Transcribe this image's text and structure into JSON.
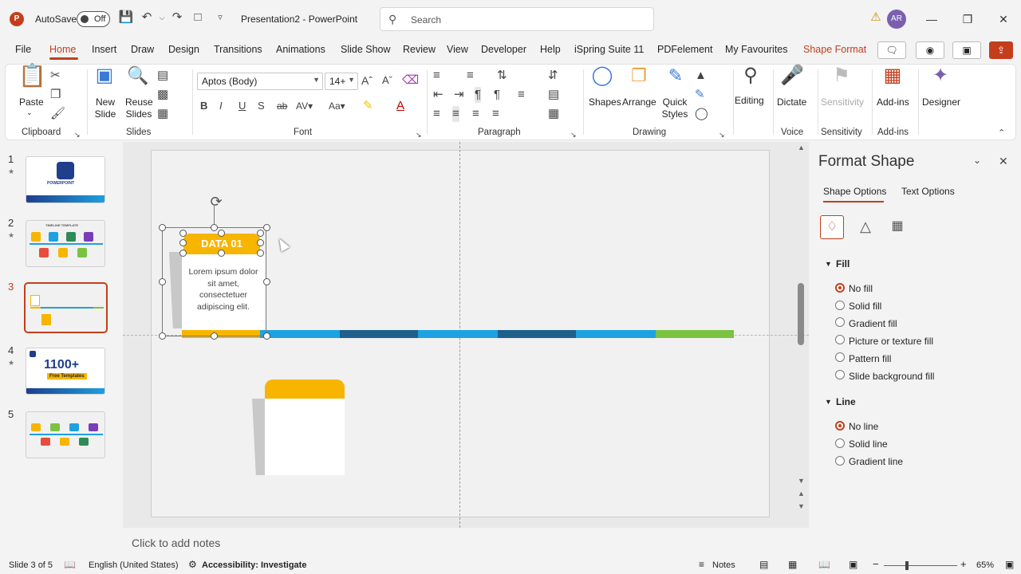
{
  "titlebar": {
    "autosave_label": "AutoSave",
    "autosave_state": "Off",
    "doc_title": "Presentation2  -  PowerPoint",
    "search_placeholder": "Search",
    "user_initials": "AR"
  },
  "menu": {
    "items": [
      "File",
      "Home",
      "Insert",
      "Draw",
      "Design",
      "Transitions",
      "Animations",
      "Slide Show",
      "Review",
      "View",
      "Developer",
      "Help",
      "iSpring Suite 11",
      "PDFelement",
      "My Favourites",
      "Shape Format"
    ],
    "active": "Home"
  },
  "ribbon": {
    "clipboard": {
      "paste": "Paste",
      "group": "Clipboard"
    },
    "slides": {
      "new_slide": "New Slide",
      "reuse_slides": "Reuse Slides",
      "group": "Slides"
    },
    "font": {
      "family": "Aptos (Body)",
      "size": "14+",
      "group": "Font",
      "bold": "B",
      "italic": "I",
      "underline": "U",
      "shadow": "S",
      "strike": "ab"
    },
    "paragraph": {
      "group": "Paragraph"
    },
    "drawing": {
      "shapes": "Shapes",
      "arrange": "Arrange",
      "quick_styles": "Quick Styles",
      "group": "Drawing"
    },
    "editing": {
      "label": "Editing"
    },
    "voice": {
      "dictate": "Dictate",
      "group": "Voice"
    },
    "sensitivity": {
      "label": "Sensitivity",
      "group": "Sensitivity"
    },
    "addins": {
      "label": "Add-ins",
      "group": "Add-ins"
    },
    "designer": {
      "label": "Designer"
    }
  },
  "thumbnails": [
    {
      "num": "1",
      "star": "★",
      "caption": "POWERPOINT"
    },
    {
      "num": "2",
      "star": "★",
      "caption": "TIMELINE TEMPLATE"
    },
    {
      "num": "3",
      "star": ""
    },
    {
      "num": "4",
      "star": "★",
      "big": "1100+",
      "sub": "Free Templates"
    },
    {
      "num": "5",
      "star": ""
    }
  ],
  "slide": {
    "data_label": "DATA 01",
    "body_text": "Lorem ipsum dolor sit amet, consectetuer adipiscing elit."
  },
  "colors": {
    "accent": "#c43e1c",
    "yellow": "#f7b500",
    "blue": "#1da1e0",
    "dark_blue": "#1f5f8b",
    "green": "#7cc242"
  },
  "notes": {
    "placeholder": "Click to add notes"
  },
  "format_pane": {
    "title": "Format Shape",
    "tabs": [
      "Shape Options",
      "Text Options"
    ],
    "fill": {
      "header": "Fill",
      "options": [
        "No fill",
        "Solid fill",
        "Gradient fill",
        "Picture or texture fill",
        "Pattern fill",
        "Slide background fill"
      ],
      "selected": "No fill"
    },
    "line": {
      "header": "Line",
      "options": [
        "No line",
        "Solid line",
        "Gradient line"
      ],
      "selected": "No line"
    }
  },
  "status": {
    "slide_info": "Slide 3 of 5",
    "language": "English (United States)",
    "accessibility": "Accessibility: Investigate",
    "notes": "Notes",
    "zoom": "65%"
  }
}
